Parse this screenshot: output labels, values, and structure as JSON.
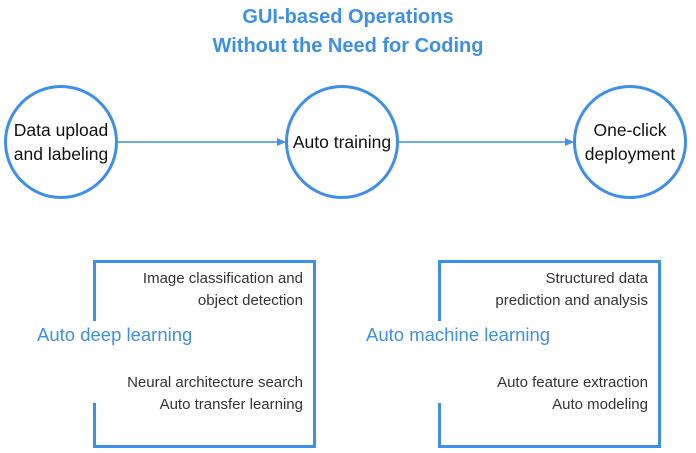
{
  "title": {
    "line1": "GUI-based Operations",
    "line2": "Without the Need for Coding"
  },
  "flow": {
    "steps": [
      {
        "line1": "Data upload",
        "line2": "and labeling"
      },
      {
        "line1": "Auto training"
      },
      {
        "line1": "One-click",
        "line2": "deployment"
      }
    ]
  },
  "panels": [
    {
      "label": "Auto deep learning",
      "top_lines": [
        "Image classification and",
        "object detection"
      ],
      "bottom_lines": [
        "Neural architecture search",
        "Auto transfer learning"
      ]
    },
    {
      "label": "Auto machine learning",
      "top_lines": [
        "Structured data",
        "prediction and analysis"
      ],
      "bottom_lines": [
        "Auto feature extraction",
        "Auto modeling"
      ]
    }
  ],
  "colors": {
    "accent": "#3d8fe8",
    "text": "#111111",
    "subtext": "#333333"
  }
}
